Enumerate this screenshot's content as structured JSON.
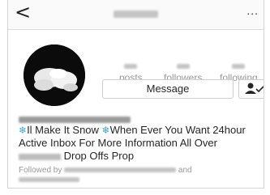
{
  "header": {
    "back_glyph": "<",
    "more_glyph": "..."
  },
  "stats": {
    "posts_label": "posts",
    "followers_label": "followers",
    "following_label": "following"
  },
  "actions": {
    "message_label": "Message",
    "following_icon": "person-check-icon"
  },
  "bio": {
    "icon": "snowflake-icon",
    "snow_glyph": "❄",
    "line_a": "Il Make It Snow ",
    "line_b": "When Ever You Want 24hour Active Inbox For More Information All Over ",
    "line_c": " Drop Offs Prop"
  },
  "followed_by": {
    "prefix": "Followed by ",
    "and": " and"
  },
  "colors": {
    "accent_icon": "#3da5dc",
    "muted_text": "#999999"
  }
}
